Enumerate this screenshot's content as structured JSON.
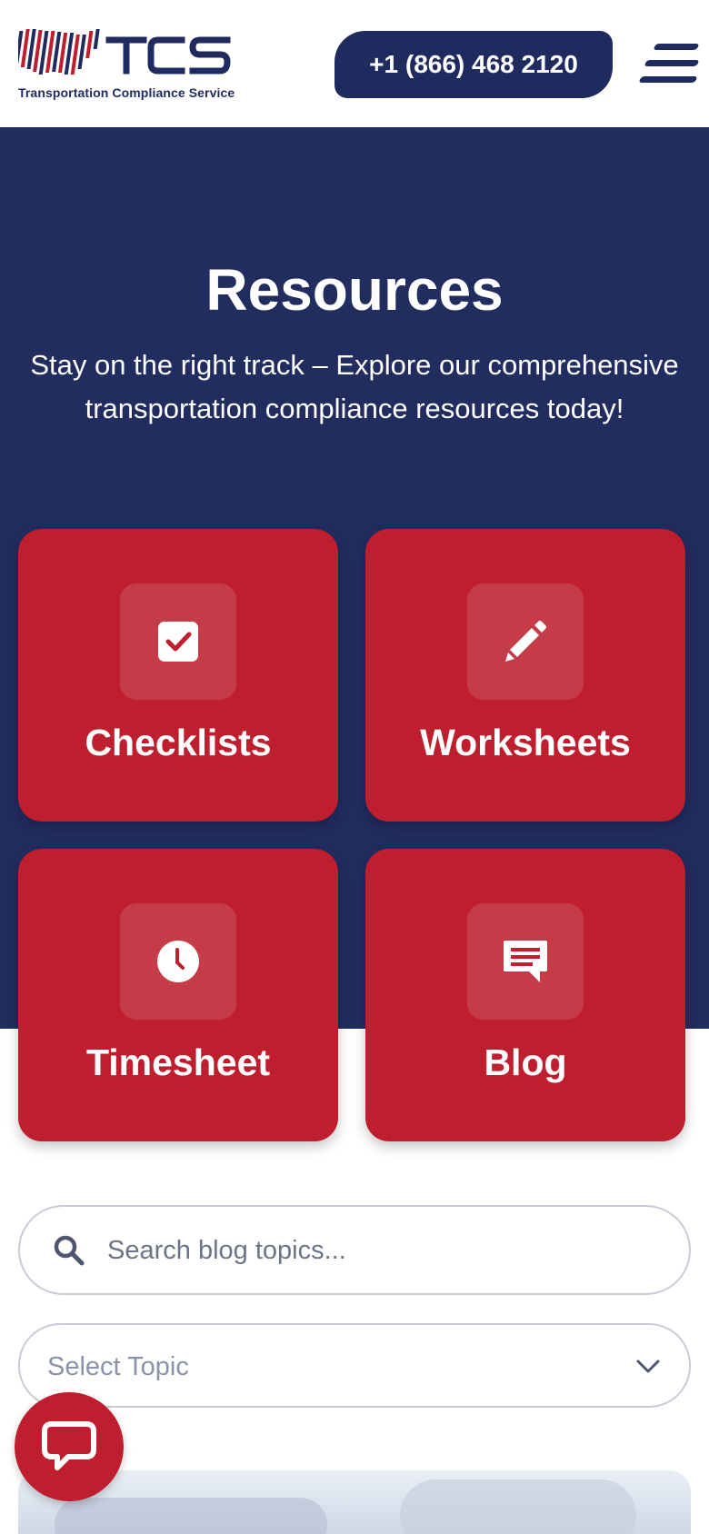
{
  "header": {
    "logo_mark": "TCS",
    "logo_tagline": "Transportation Compliance Service",
    "phone_label": "+1 (866) 468 2120"
  },
  "hero": {
    "title": "Resources",
    "subtitle": "Stay on the right track – Explore our comprehensive transportation compliance resources today!"
  },
  "cards": [
    {
      "label": "Checklists",
      "icon": "checkbox-icon"
    },
    {
      "label": "Worksheets",
      "icon": "pencil-icon"
    },
    {
      "label": "Timesheet",
      "icon": "clock-icon"
    },
    {
      "label": "Blog",
      "icon": "comment-icon"
    }
  ],
  "search": {
    "placeholder": "Search blog topics..."
  },
  "topic_select": {
    "value": "Select Topic"
  },
  "colors": {
    "navy": "#212c5f",
    "red": "#be1e2d",
    "white": "#ffffff"
  }
}
